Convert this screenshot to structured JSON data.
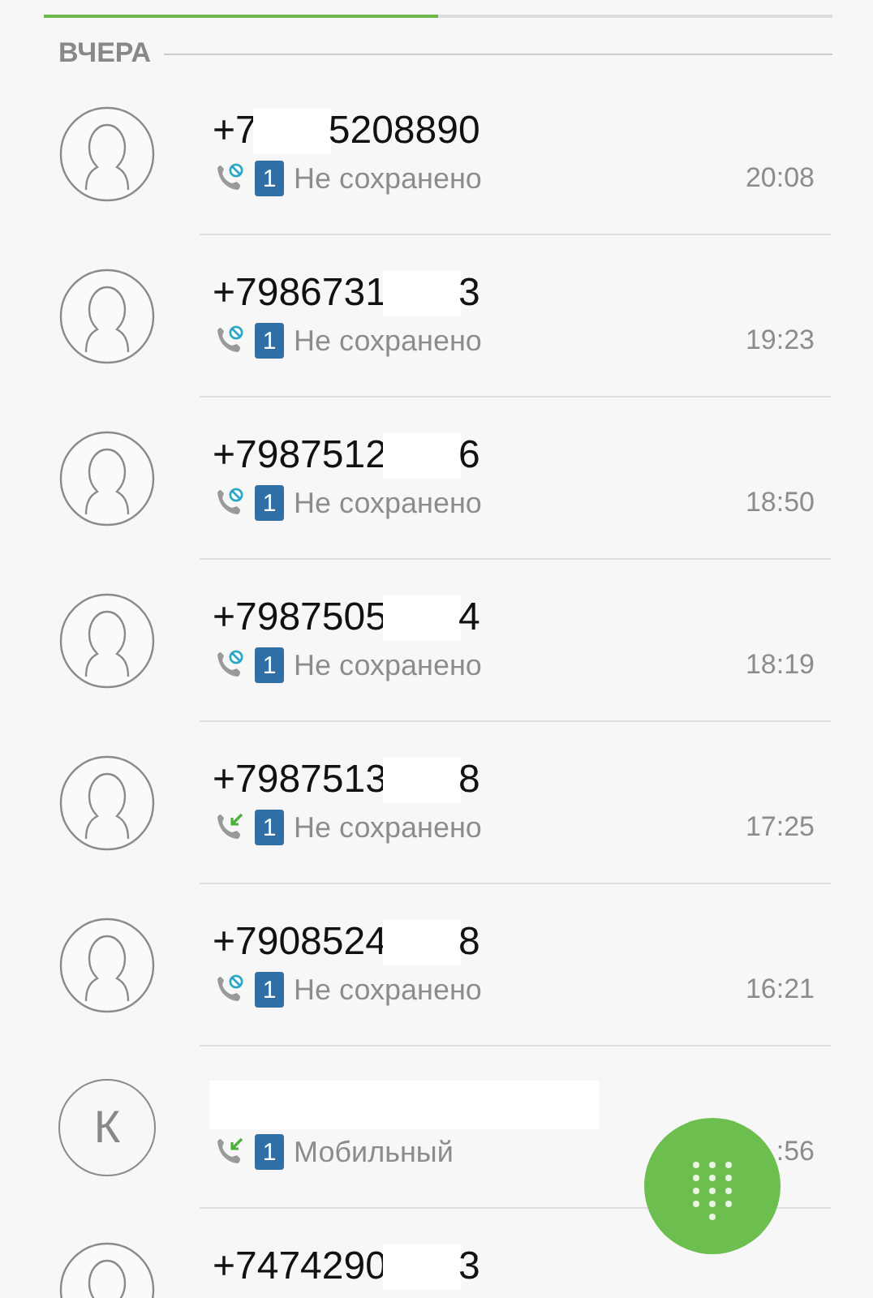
{
  "section": {
    "title": "ВЧЕРА",
    "tab_indicator": {
      "level": 0.5
    }
  },
  "calls": [
    {
      "avatar": {
        "kind": "silhouette"
      },
      "number_parts": [
        "+7",
        "5208890"
      ],
      "kind": "blocked",
      "sim": "1",
      "label": "Не сохранено",
      "time": "20:08"
    },
    {
      "avatar": {
        "kind": "silhouette"
      },
      "number_parts": [
        "+7986731",
        "3"
      ],
      "kind": "blocked",
      "sim": "1",
      "label": "Не сохранено",
      "time": "19:23"
    },
    {
      "avatar": {
        "kind": "silhouette"
      },
      "number_parts": [
        "+7987512",
        "6"
      ],
      "kind": "blocked",
      "sim": "1",
      "label": "Не сохранено",
      "time": "18:50"
    },
    {
      "avatar": {
        "kind": "silhouette"
      },
      "number_parts": [
        "+7987505",
        "4"
      ],
      "kind": "blocked",
      "sim": "1",
      "label": "Не сохранено",
      "time": "18:19"
    },
    {
      "avatar": {
        "kind": "silhouette"
      },
      "number_parts": [
        "+7987513",
        "8"
      ],
      "kind": "incoming",
      "sim": "1",
      "label": "Не сохранено",
      "time": "17:25"
    },
    {
      "avatar": {
        "kind": "silhouette"
      },
      "number_parts": [
        "+7908524",
        "8"
      ],
      "kind": "blocked",
      "sim": "1",
      "label": "Не сохранено",
      "time": "16:21"
    },
    {
      "avatar": {
        "kind": "letter",
        "letter": "К"
      },
      "kind": "incoming",
      "sim": "1",
      "label": "Мобильный",
      "time": ":56"
    },
    {
      "avatar": {
        "kind": "silhouette"
      },
      "number_parts": [
        "+7474290",
        "3"
      ]
    }
  ]
}
